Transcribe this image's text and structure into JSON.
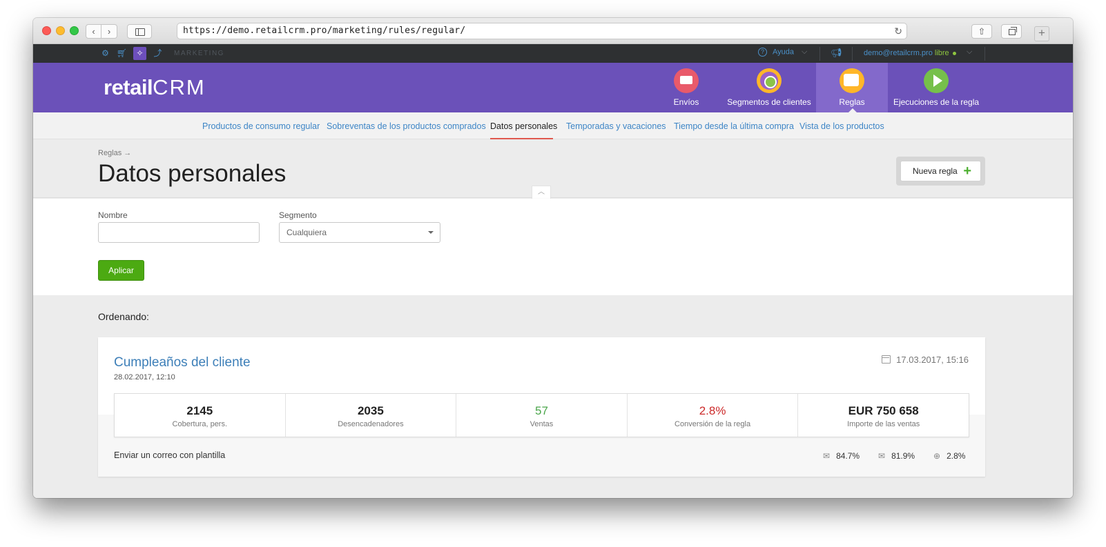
{
  "browser": {
    "url": "https://demo.retailcrm.pro/marketing/rules/regular/"
  },
  "topbar": {
    "section": "MARKETING",
    "help": "Ayuda",
    "user_email": "demo@retailcrm.pro",
    "user_plan": "libre"
  },
  "header": {
    "logo_left": "retail",
    "logo_right": "CRM",
    "modules": [
      {
        "label": "Envíos",
        "icon": "envelope-icon"
      },
      {
        "label": "Segmentos de clientes",
        "icon": "segments-icon"
      },
      {
        "label": "Reglas",
        "icon": "rules-icon",
        "active": true
      },
      {
        "label": "Ejecuciones de la regla",
        "icon": "play-icon"
      }
    ],
    "accent": "#6b51b9"
  },
  "subnav": {
    "items": [
      {
        "label": "Productos de consumo regular"
      },
      {
        "label": "Sobreventas de los productos comprados"
      },
      {
        "label": "Datos personales",
        "active": true
      },
      {
        "label": "Temporadas y vacaciones"
      },
      {
        "label": "Tiempo desde la última compra"
      },
      {
        "label": "Vista de los productos"
      }
    ]
  },
  "page": {
    "breadcrumb": "Reglas →",
    "title": "Datos personales",
    "new_rule_label": "Nueva regla"
  },
  "filter": {
    "name_label": "Nombre",
    "name_value": "",
    "segment_label": "Segmento",
    "segment_value": "Cualquiera",
    "apply_label": "Aplicar"
  },
  "list": {
    "sorting_label": "Ordenando:",
    "rules": [
      {
        "name": "Cumpleaños del cliente",
        "created": "28.02.2017, 12:10",
        "updated": "17.03.2017, 15:16",
        "stats": [
          {
            "value": "2145",
            "label": "Cobertura, pers."
          },
          {
            "value": "2035",
            "label": "Desencadenadores"
          },
          {
            "value": "57",
            "label": "Ventas",
            "color": "#4aa64a"
          },
          {
            "value": "2.8%",
            "label": "Conversión de la regla",
            "color": "#cc2a2a"
          },
          {
            "value": "EUR 750 658",
            "label": "Importe de las ventas"
          }
        ],
        "action": "Enviar un correo con plantilla",
        "metrics": [
          {
            "icon": "mail-sent-icon",
            "value": "84.7%"
          },
          {
            "icon": "mail-open-icon",
            "value": "81.9%"
          },
          {
            "icon": "click-icon",
            "value": "2.8%"
          }
        ]
      }
    ]
  }
}
